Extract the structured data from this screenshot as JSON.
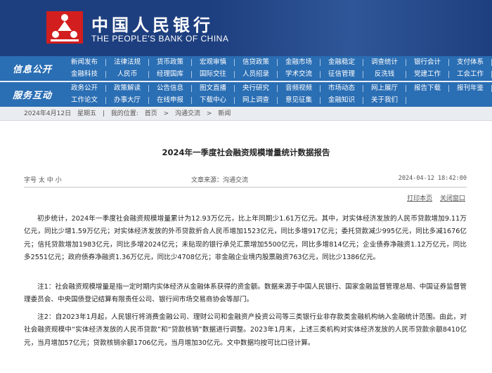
{
  "header": {
    "brand_cn": "中国人民银行",
    "brand_en": "THE PEOPLE'S BANK OF CHINA"
  },
  "nav": {
    "rows": [
      {
        "label": "信息公开",
        "links": [
          [
            "新闻发布",
            "法律法规",
            "货币政策",
            "宏观审慎",
            "信贷政策",
            "金融市场",
            "金融稳定",
            "调查统计",
            "银行会计",
            "支付体系"
          ],
          [
            "金融科技",
            "人民币",
            "经理国库",
            "国际交往",
            "人员招录",
            "学术交流",
            "征信管理",
            "反洗钱",
            "党建工作",
            "工会工作"
          ]
        ]
      },
      {
        "label": "服务互动",
        "links": [
          [
            "政务公开",
            "政策解读",
            "公告信息",
            "图文直播",
            "央行研究",
            "音频视频",
            "市场动态",
            "网上展厅",
            "报告下载",
            "报刊年鉴"
          ],
          [
            "工作论文",
            "办事大厅",
            "在线申报",
            "下载中心",
            "网上调查",
            "意见征集",
            "金融知识",
            "关于我们"
          ]
        ]
      }
    ]
  },
  "breadcrumb": {
    "date": "2024年4月12日",
    "weekday": "星期五",
    "prefix": "我的位置:",
    "items": [
      "首页",
      "沟通交流",
      "新闻"
    ],
    "sep": ">"
  },
  "article": {
    "title": "2024年一季度社会融资规模增量统计数据报告",
    "font_size_label": "字号 太 中 小",
    "source_label": "文章来源：沟通交流",
    "date": "2024-04-12 18:42:00",
    "print_label": "打印本页",
    "close_label": "关闭窗口",
    "paragraphs": [
      "初步统计，2024年一季度社会融资规模增量累计为12.93万亿元，比上年同期少1.61万亿元。其中，对实体经济发放的人民币贷款增加9.11万亿元，同比少增1.59万亿元；对实体经济发放的外币贷款折合人民币增加1523亿元，同比多增917亿元；委托贷款减少995亿元，同比多减1676亿元；信托贷款增加1983亿元，同比多增2024亿元；未贴现的银行承兑汇票增加5500亿元，同比多增814亿元；企业债券净融资1.12万亿元，同比多2551亿元；政府债券净融资1.36万亿元，同比少4708亿元；非金融企业境内股票融资763亿元，同比少1386亿元。",
      "注1：社会融资规模增量是指一定时期内实体经济从金融体系获得的资金额。数据来源于中国人民银行、国家金融监督管理总局、中国证券监督管理委员会、中央国债登记结算有限责任公司、银行间市场交易商协会等部门。",
      "注2：自2023年1月起，人民银行将消费金融公司、理财公司和金融资产投资公司等三类银行业非存款类金融机构纳入金融统计范围。由此，对社会融资规模中“实体经济发放的人民币贷款”和“贷款核销”数据进行调整。2023年1月末，上述三类机构对实体经济发放的人民币贷款余额8410亿元，当月增加57亿元；贷款核销余额1706亿元，当月增加30亿元。文中数据均按可比口径计算。"
    ]
  },
  "colors": {
    "header_bg": "#1e3f7f",
    "nav_bg": "#2a6eb4",
    "logo_red": "#d21e1e"
  }
}
